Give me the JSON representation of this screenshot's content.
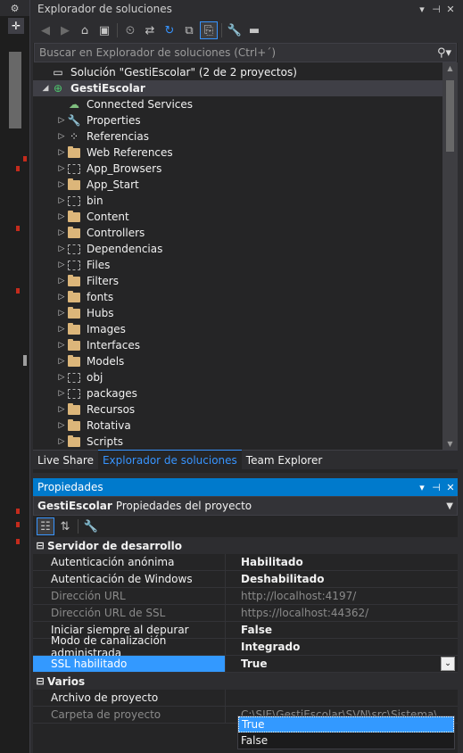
{
  "solution_explorer": {
    "title": "Explorador de soluciones",
    "search_placeholder": "Buscar en Explorador de soluciones (Ctrl+´)",
    "solution_label": "Solución \"GestiEscolar\" (2 de 2 proyectos)",
    "project_label": "GestiEscolar",
    "items": [
      {
        "label": "Connected Services",
        "icon": "connected-services-icon"
      },
      {
        "label": "Properties",
        "icon": "wrench-icon"
      },
      {
        "label": "Referencias",
        "icon": "references-icon"
      },
      {
        "label": "Web References",
        "icon": "folder-icon"
      },
      {
        "label": "App_Browsers",
        "icon": "dashed-folder-icon"
      },
      {
        "label": "App_Start",
        "icon": "folder-icon"
      },
      {
        "label": "bin",
        "icon": "dashed-folder-icon"
      },
      {
        "label": "Content",
        "icon": "folder-icon"
      },
      {
        "label": "Controllers",
        "icon": "folder-icon"
      },
      {
        "label": "Dependencias",
        "icon": "dashed-folder-icon"
      },
      {
        "label": "Files",
        "icon": "dashed-folder-icon"
      },
      {
        "label": "Filters",
        "icon": "folder-icon"
      },
      {
        "label": "fonts",
        "icon": "folder-icon"
      },
      {
        "label": "Hubs",
        "icon": "folder-icon"
      },
      {
        "label": "Images",
        "icon": "folder-icon"
      },
      {
        "label": "Interfaces",
        "icon": "folder-icon"
      },
      {
        "label": "Models",
        "icon": "folder-icon"
      },
      {
        "label": "obj",
        "icon": "dashed-folder-icon"
      },
      {
        "label": "packages",
        "icon": "dashed-folder-icon"
      },
      {
        "label": "Recursos",
        "icon": "folder-icon"
      },
      {
        "label": "Rotativa",
        "icon": "folder-icon"
      },
      {
        "label": "Scripts",
        "icon": "folder-icon"
      }
    ]
  },
  "tabs": [
    "Live Share",
    "Explorador de soluciones",
    "Team Explorer"
  ],
  "properties": {
    "title": "Propiedades",
    "object_name": "GestiEscolar",
    "object_desc": "Propiedades del proyecto",
    "categories": [
      {
        "name": "Servidor de desarrollo",
        "rows": [
          {
            "name": "Autenticación anónima",
            "value": "Habilitado",
            "readonly": false
          },
          {
            "name": "Autenticación de Windows",
            "value": "Deshabilitado",
            "readonly": false
          },
          {
            "name": "Dirección URL",
            "value": "http://localhost:4197/",
            "readonly": true
          },
          {
            "name": "Dirección URL de SSL",
            "value": "https://localhost:44362/",
            "readonly": true
          },
          {
            "name": "Iniciar siempre al depurar",
            "value": "False",
            "readonly": false
          },
          {
            "name": "Modo de canalización administrada",
            "value": "Integrado",
            "readonly": false
          },
          {
            "name": "SSL habilitado",
            "value": "True",
            "readonly": false,
            "selected": true
          }
        ]
      },
      {
        "name": "Varios",
        "rows": [
          {
            "name": "Archivo de proyecto",
            "value": "",
            "readonly": false
          },
          {
            "name": "Carpeta de proyecto",
            "value": "C:\\SIE\\GestiEscolar\\SVN\\src\\Sistema\\",
            "readonly": true
          }
        ]
      }
    ],
    "dropdown_options": [
      "True",
      "False"
    ],
    "dropdown_highlighted": "True"
  },
  "colors": {
    "accent": "#007acc",
    "selection": "#3399ff",
    "folder": "#dcb67a"
  }
}
